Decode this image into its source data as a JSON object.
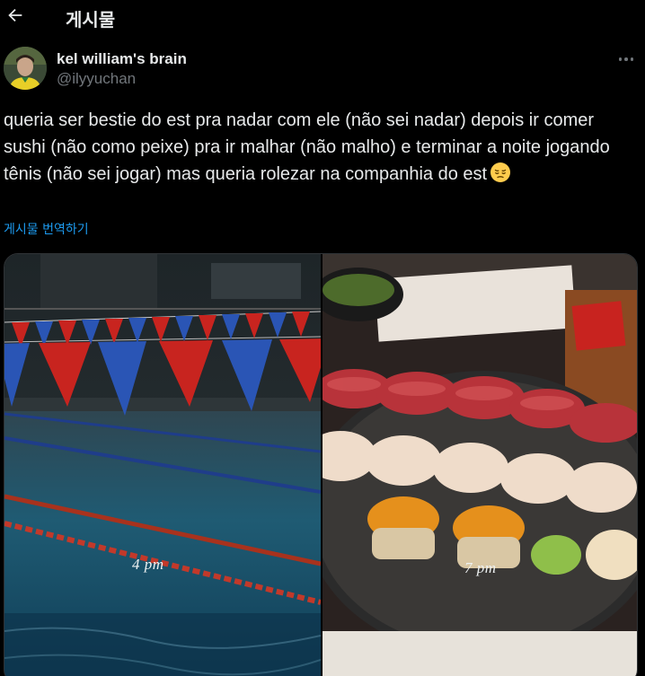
{
  "header": {
    "title": "게시물",
    "back_icon": "arrow-left-icon"
  },
  "author": {
    "display_name": "kel william's brain",
    "handle": "@ilyyuchan",
    "avatar_icon": "profile-avatar"
  },
  "tweet": {
    "text": "queria ser bestie do est pra nadar com ele (não sei nadar) depois ir comer sushi (não como peixe) pra ir malhar (não malho) e terminar a noite jogando tênis (não sei jogar) mas queria rolezar na companhia do est",
    "emoji_icon": "pensive-face-icon",
    "translate_label": "게시물 번역하기"
  },
  "media": {
    "photos": [
      {
        "caption": "4 pm",
        "scene": "pool-icon"
      },
      {
        "caption": "7 pm",
        "scene": "sushi-icon"
      }
    ]
  },
  "colors": {
    "background": "#000000",
    "text": "#e7e9ea",
    "muted": "#71767b",
    "link": "#1d9bf0"
  }
}
